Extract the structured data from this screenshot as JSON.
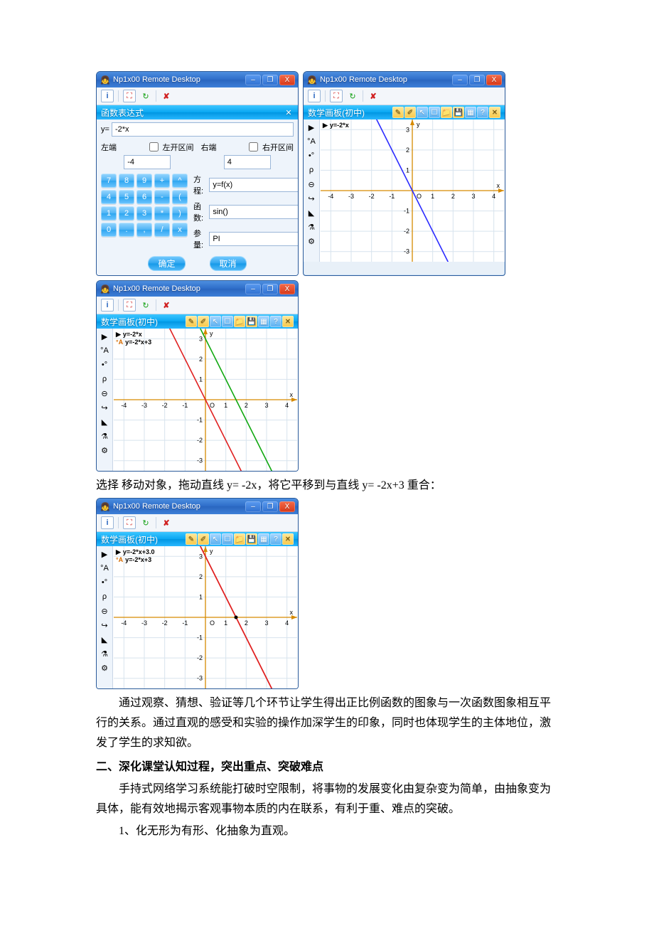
{
  "windows": {
    "title": "Np1x00 Remote Desktop",
    "minimize": "–",
    "maximize": "❐",
    "close": "X",
    "info_icon": "i",
    "fullscreen_icon": "⛶",
    "refresh_icon": "↻",
    "x_icon": "✘"
  },
  "expr_editor": {
    "panel_title": "函数表达式",
    "y_label": "y=",
    "y_value": "-2*x",
    "left_end_label": "左端",
    "left_open_label": "左开区间",
    "left_open_checked": false,
    "left_value": "-4",
    "right_end_label": "右端",
    "right_open_label": "右开区间",
    "right_open_checked": false,
    "right_value": "4",
    "keypad": [
      "7",
      "8",
      "9",
      "+",
      "^",
      "4",
      "5",
      "6",
      "-",
      "(",
      "1",
      "2",
      "3",
      "*",
      ")",
      "0",
      ".",
      ",",
      "/",
      "x"
    ],
    "equation_label": "方程:",
    "equation_value": "y=f(x)",
    "function_label": "函数:",
    "function_value": "sin()",
    "param_label": "参量:",
    "param_value": "PI",
    "ok": "确定",
    "cancel": "取消"
  },
  "graph_panels": {
    "panel_title": "数学画板(初中)",
    "tool_icons": [
      "✎",
      "✐",
      "↖",
      "☐",
      "📁",
      "💾",
      "▦",
      "?",
      "✕"
    ],
    "side_tools": [
      "▶",
      "°A",
      "•°",
      "ρ",
      "⊖",
      "↪",
      "◣",
      "⚗",
      "⚙"
    ],
    "top_right": {
      "legend": [
        {
          "label": "y=-2*x",
          "symbol": "▶",
          "color": "#000"
        }
      ],
      "x_label": "x",
      "y_label": "y"
    },
    "mid_left": {
      "legend": [
        {
          "label": "y=-2*x",
          "symbol": "▶",
          "color": "#000"
        },
        {
          "label": "y=-2*x+3",
          "symbol": "°A",
          "color": "#d46a00"
        }
      ],
      "x_label": "x",
      "y_label": "y"
    },
    "bottom_left": {
      "legend": [
        {
          "label": "y=-2*x+3.0",
          "symbol": "▶",
          "color": "#000"
        },
        {
          "label": "y=-2*x+3",
          "symbol": "°A",
          "color": "#d46a00"
        }
      ],
      "x_label": "x",
      "y_label": "y"
    }
  },
  "chart_data": [
    {
      "panel": "top_right",
      "type": "line",
      "xlim": [
        -4.5,
        4.5
      ],
      "ylim": [
        -3.5,
        3.5
      ],
      "xticks": [
        -4,
        -3,
        -2,
        -1,
        0,
        1,
        2,
        3,
        4
      ],
      "yticks": [
        -3,
        -2,
        -1,
        1,
        2,
        3
      ],
      "xlabel": "x",
      "ylabel": "y",
      "grid": true,
      "series": [
        {
          "name": "y=-2*x",
          "color": "#2b2bff",
          "x": [
            -2,
            2
          ],
          "y": [
            4,
            -4
          ]
        }
      ]
    },
    {
      "panel": "mid_left",
      "type": "line",
      "xlim": [
        -4.5,
        4.5
      ],
      "ylim": [
        -3.5,
        3.5
      ],
      "xticks": [
        -4,
        -3,
        -2,
        -1,
        0,
        1,
        2,
        3,
        4
      ],
      "yticks": [
        -3,
        -2,
        -1,
        1,
        2,
        3
      ],
      "xlabel": "x",
      "ylabel": "y",
      "grid": true,
      "series": [
        {
          "name": "y=-2*x",
          "color": "#e02020",
          "x": [
            -2,
            2
          ],
          "y": [
            4,
            -4
          ]
        },
        {
          "name": "y=-2*x+3",
          "color": "#10a810",
          "x": [
            -0.5,
            3.5
          ],
          "y": [
            4,
            -4
          ]
        }
      ]
    },
    {
      "panel": "bottom_left",
      "type": "line",
      "xlim": [
        -4.5,
        4.5
      ],
      "ylim": [
        -3.5,
        3.5
      ],
      "xticks": [
        -4,
        -3,
        -2,
        -1,
        0,
        1,
        2,
        3,
        4
      ],
      "yticks": [
        -3,
        -2,
        -1,
        1,
        2,
        3
      ],
      "xlabel": "x",
      "ylabel": "y",
      "grid": true,
      "series": [
        {
          "name": "y=-2*x+3",
          "color": "#e02020",
          "x": [
            -0.5,
            3.5
          ],
          "y": [
            4,
            -4
          ]
        },
        {
          "name": "y=-2*x+3.0",
          "color": "#e02020",
          "x": [
            -0.5,
            3.5
          ],
          "y": [
            4,
            -4
          ]
        }
      ],
      "markers": [
        {
          "x": 1.5,
          "y": 0,
          "color": "#000"
        }
      ]
    }
  ],
  "text": {
    "between": {
      "pre": "选择 移动对象，拖动直线 ",
      "f1": "y= -2x",
      "mid": "，将它平移到与直线 ",
      "f2": "y= -2x+3 ",
      "post": "重合："
    },
    "para1": "通过观察、猜想、验证等几个环节让学生得出正比例函数的图象与一次函数图象相互平行的关系。通过直观的感受和实验的操作加深学生的印象，同时也体现学生的主体地位，激发了学生的求知欲。",
    "heading2": "二、深化课堂认知过程，突出重点、突破难点",
    "para2": "手持式网络学习系统能打破时空限制，将事物的发展变化由复杂变为简单，由抽象变为具体，能有效地揭示客观事物本质的内在联系，有利于重、难点的突破。",
    "item1": "1、化无形为有形、化抽象为直观。"
  }
}
